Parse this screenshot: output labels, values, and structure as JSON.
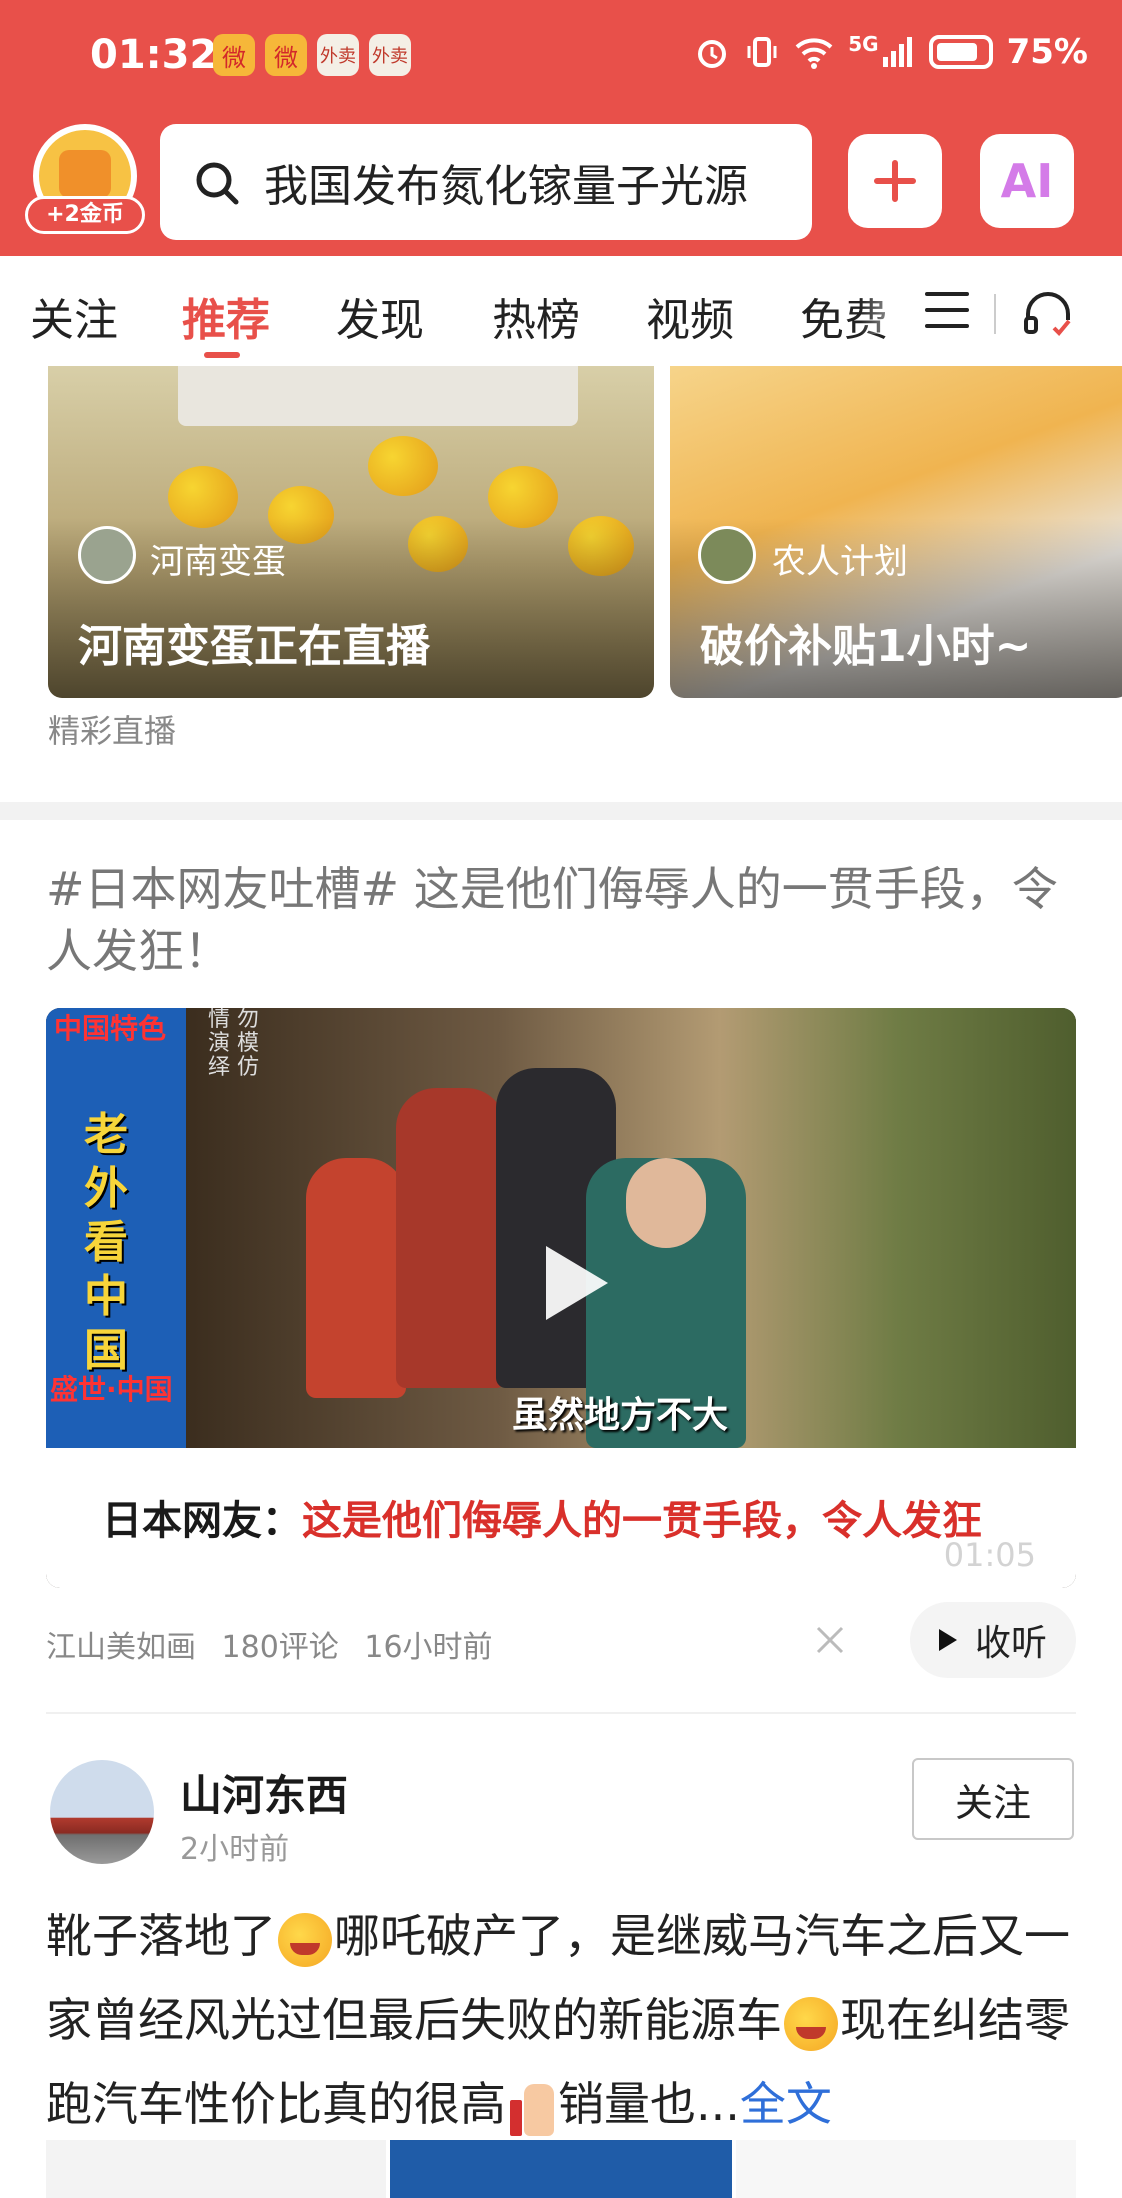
{
  "status_bar": {
    "time": "01:32",
    "network": "5G",
    "battery": "75%",
    "notification_apps": [
      "weibo",
      "weibo",
      "点外卖",
      "点外卖"
    ]
  },
  "header": {
    "coin_badge": "+2金币",
    "search_text": "我国发布氮化镓量子光源",
    "add_icon": "plus-icon",
    "ai_label": "AI"
  },
  "tabs": [
    "关注",
    "推荐",
    "发现",
    "热榜",
    "视频",
    "免费"
  ],
  "active_tab": "推荐",
  "live": {
    "cards": [
      {
        "author": "河南变蛋",
        "title": "河南变蛋正在直播"
      },
      {
        "author": "农人计划",
        "title": "破价补贴1小时~"
      }
    ],
    "section_label": "精彩直播"
  },
  "post1": {
    "title": "#日本网友吐槽# 这是他们侮辱人的一贯手段，令人发狂！",
    "video": {
      "side_corner": "中国特色",
      "side_text": "老外看中国",
      "side_bottom": "盛世·中国",
      "note": "情 勿\n演 模\n绎 仿",
      "subtitle": "虽然地方不大",
      "caption_prefix": "日本网友：",
      "caption_main": "这是他们侮辱人的一贯手段，令人发狂",
      "duration": "01:05"
    },
    "source": "江山美如画",
    "comments": "180评论",
    "time": "16小时前",
    "listen_label": "收听"
  },
  "post2": {
    "author": "山河东西",
    "time": "2小时前",
    "follow_label": "关注",
    "text_part1": "靴子落地了",
    "text_part2": "哪吒破产了，是继威马汽车之后又一家曾经风光过但最后失败的新能源车",
    "text_part3": "现在纠结零跑汽车性价比真的很高",
    "text_part4": "销量也...",
    "more_label": "全文"
  },
  "colors": {
    "brand_red": "#e8504a",
    "link_blue": "#2f6fd9",
    "caption_red": "#d9302b"
  }
}
